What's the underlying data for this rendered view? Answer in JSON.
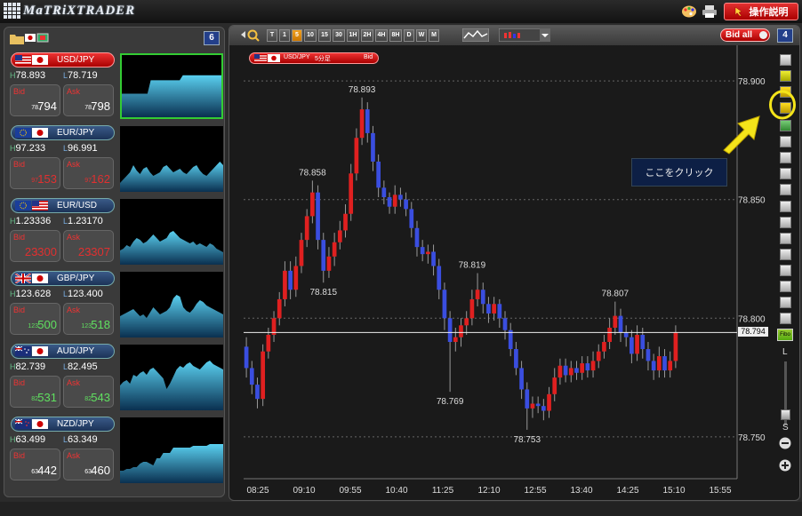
{
  "app": {
    "title": "MaTRiXTRADER",
    "help_button": "操作説明"
  },
  "left_panel": {
    "count": "6",
    "pairs": [
      {
        "name": "USD/JPY",
        "base": "us",
        "quote": "jp",
        "high": "78.893",
        "low": "78.719",
        "bid_pre": "78.",
        "bid": "794",
        "ask_pre": "78.",
        "ask": "798",
        "bid_color": "#ffffff",
        "ask_color": "#ffffff",
        "selected": true,
        "spark": [
          28,
          28,
          28,
          28,
          28,
          28,
          28,
          28,
          28,
          44,
          44,
          44,
          44,
          44,
          44,
          44,
          44,
          44,
          44,
          50,
          50,
          50,
          50,
          50,
          50,
          50,
          50,
          50,
          50,
          50,
          50,
          50
        ]
      },
      {
        "name": "EUR/JPY",
        "base": "eu",
        "quote": "jp",
        "high": "97.233",
        "low": "96.991",
        "bid_pre": "97.",
        "bid": "153",
        "ask_pre": "97.",
        "ask": "162",
        "bid_color": "#e03030",
        "ask_color": "#e03030",
        "selected": false,
        "spark": [
          10,
          14,
          18,
          22,
          30,
          24,
          20,
          26,
          28,
          22,
          18,
          20,
          22,
          28,
          30,
          26,
          22,
          24,
          26,
          22,
          20,
          24,
          28,
          30,
          24,
          20,
          18,
          22,
          26,
          30,
          34,
          30
        ]
      },
      {
        "name": "EUR/USD",
        "base": "eu",
        "quote": "us",
        "high": "1.23336",
        "low": "1.23170",
        "bid_pre": "1.",
        "bid": "23300",
        "ask_pre": "1.",
        "ask": "23307",
        "bid_color": "#e03030",
        "ask_color": "#e03030",
        "selected": false,
        "spark": [
          16,
          18,
          22,
          20,
          26,
          30,
          28,
          24,
          26,
          30,
          34,
          30,
          26,
          28,
          30,
          36,
          38,
          34,
          30,
          28,
          26,
          24,
          26,
          22,
          24,
          22,
          20,
          24,
          22,
          18,
          16,
          14
        ]
      },
      {
        "name": "GBP/JPY",
        "base": "gb",
        "quote": "jp",
        "high": "123.628",
        "low": "123.400",
        "bid_pre": "123.",
        "bid": "500",
        "ask_pre": "123.",
        "ask": "518",
        "bid_color": "#60e060",
        "ask_color": "#60e060",
        "selected": false,
        "spark": [
          24,
          26,
          28,
          30,
          32,
          28,
          24,
          26,
          22,
          28,
          34,
          30,
          26,
          28,
          30,
          34,
          44,
          48,
          46,
          34,
          30,
          28,
          32,
          38,
          42,
          40,
          36,
          34,
          32,
          30,
          28,
          26
        ]
      },
      {
        "name": "AUD/JPY",
        "base": "au",
        "quote": "jp",
        "high": "82.739",
        "low": "82.495",
        "bid_pre": "82.",
        "bid": "531",
        "ask_pre": "82.",
        "ask": "543",
        "bid_color": "#60e060",
        "ask_color": "#60e060",
        "selected": false,
        "spark": [
          28,
          32,
          34,
          30,
          40,
          38,
          42,
          44,
          40,
          46,
          48,
          44,
          40,
          36,
          24,
          30,
          38,
          46,
          50,
          48,
          52,
          54,
          50,
          48,
          46,
          50,
          54,
          56,
          52,
          50,
          48,
          46
        ]
      },
      {
        "name": "NZD/JPY",
        "base": "nz",
        "quote": "jp",
        "high": "63.499",
        "low": "63.349",
        "bid_pre": "63.",
        "bid": "442",
        "ask_pre": "63.",
        "ask": "460",
        "bid_color": "#ffffff",
        "ask_color": "#ffffff",
        "selected": false,
        "spark": [
          14,
          14,
          16,
          16,
          18,
          18,
          22,
          24,
          24,
          22,
          20,
          28,
          28,
          34,
          34,
          34,
          40,
          40,
          40,
          40,
          40,
          40,
          42,
          42,
          42,
          42,
          42,
          44,
          44,
          44,
          44,
          44
        ]
      }
    ]
  },
  "chart": {
    "toolbar": {
      "timeframes": [
        "T",
        "1",
        "5",
        "10",
        "15",
        "30",
        "1H",
        "2H",
        "4H",
        "8H",
        "D",
        "W",
        "M"
      ],
      "active_timeframe": "5",
      "bid_all": "Bid all",
      "badge": "4"
    },
    "symbol_chip": {
      "pair": "USD/JPY",
      "interval": "5分足",
      "side": "Bid"
    },
    "callout": "ここをクリック",
    "zoom_top": "L",
    "zoom_bottom": "S",
    "chart_data": {
      "type": "candlestick",
      "title": "",
      "xlabel": "",
      "ylabel": "",
      "ylim": [
        78.735,
        78.915
      ],
      "yticks": [
        78.9,
        78.85,
        78.8,
        78.75
      ],
      "ytick_labels": [
        "78.900",
        "78.850",
        "78.800",
        "78.750"
      ],
      "xticks": [
        "08:25",
        "09:10",
        "09:55",
        "10:40",
        "11:25",
        "12:10",
        "12:55",
        "13:40",
        "14:25",
        "15:10",
        "15:55"
      ],
      "current_price": "78.794",
      "annotations": [
        {
          "label": "78.893",
          "x": "09:55",
          "value": 78.893
        },
        {
          "label": "78.858",
          "x": "09:10",
          "value": 78.858
        },
        {
          "label": "78.815",
          "x": "09:10",
          "value": 78.815
        },
        {
          "label": "78.819",
          "x": "11:25",
          "value": 78.819
        },
        {
          "label": "78.769",
          "x": "11:25",
          "value": 78.769
        },
        {
          "label": "78.753",
          "x": "12:10",
          "value": 78.753
        },
        {
          "label": "78.807",
          "x": "13:40",
          "value": 78.807
        }
      ],
      "candles": [
        [
          78.788,
          78.779,
          78.792,
          78.775
        ],
        [
          78.779,
          78.772,
          78.782,
          78.768
        ],
        [
          78.772,
          78.766,
          78.775,
          78.762
        ],
        [
          78.766,
          78.786,
          78.789,
          78.763
        ],
        [
          78.786,
          78.793,
          78.796,
          78.783
        ],
        [
          78.793,
          78.8,
          78.803,
          78.79
        ],
        [
          78.8,
          78.808,
          78.811,
          78.797
        ],
        [
          78.808,
          78.82,
          78.824,
          78.805
        ],
        [
          78.82,
          78.812,
          78.824,
          78.808
        ],
        [
          78.812,
          78.822,
          78.826,
          78.809
        ],
        [
          78.822,
          78.833,
          78.836,
          78.819
        ],
        [
          78.833,
          78.843,
          78.846,
          78.83
        ],
        [
          78.843,
          78.853,
          78.858,
          78.84
        ],
        [
          78.853,
          78.833,
          78.856,
          78.829
        ],
        [
          78.833,
          78.82,
          78.836,
          78.815
        ],
        [
          78.82,
          78.826,
          78.83,
          78.817
        ],
        [
          78.826,
          78.832,
          78.836,
          78.822
        ],
        [
          78.832,
          78.837,
          78.841,
          78.829
        ],
        [
          78.837,
          78.844,
          78.848,
          78.834
        ],
        [
          78.844,
          78.861,
          78.865,
          78.841
        ],
        [
          78.861,
          78.876,
          78.88,
          78.858
        ],
        [
          78.876,
          78.888,
          78.893,
          78.873
        ],
        [
          78.888,
          78.878,
          78.891,
          78.874
        ],
        [
          78.878,
          78.866,
          78.881,
          78.862
        ],
        [
          78.866,
          78.855,
          78.869,
          78.851
        ],
        [
          78.855,
          78.851,
          78.858,
          78.848
        ],
        [
          78.851,
          78.847,
          78.853,
          78.844
        ],
        [
          78.847,
          78.852,
          78.856,
          78.844
        ],
        [
          78.852,
          78.85,
          78.855,
          78.847
        ],
        [
          78.85,
          78.846,
          78.853,
          78.843
        ],
        [
          78.846,
          78.838,
          78.849,
          78.834
        ],
        [
          78.838,
          78.83,
          78.841,
          78.826
        ],
        [
          78.83,
          78.827,
          78.833,
          78.824
        ],
        [
          78.827,
          78.828,
          78.831,
          78.823
        ],
        [
          78.828,
          78.822,
          78.831,
          78.818
        ],
        [
          78.822,
          78.812,
          78.825,
          78.808
        ],
        [
          78.812,
          78.8,
          78.815,
          78.795
        ],
        [
          78.8,
          78.79,
          78.803,
          78.769
        ],
        [
          78.79,
          78.792,
          78.796,
          78.786
        ],
        [
          78.792,
          78.797,
          78.8,
          78.788
        ],
        [
          78.797,
          78.8,
          78.803,
          78.793
        ],
        [
          78.8,
          78.808,
          78.812,
          78.797
        ],
        [
          78.808,
          78.812,
          78.819,
          78.805
        ],
        [
          78.812,
          78.806,
          78.815,
          78.802
        ],
        [
          78.806,
          78.802,
          78.809,
          78.798
        ],
        [
          78.802,
          78.806,
          78.809,
          78.799
        ],
        [
          78.806,
          78.8,
          78.808,
          78.796
        ],
        [
          78.8,
          78.795,
          78.803,
          78.791
        ],
        [
          78.795,
          78.787,
          78.798,
          78.784
        ],
        [
          78.787,
          78.779,
          78.79,
          78.776
        ],
        [
          78.779,
          78.77,
          78.782,
          78.766
        ],
        [
          78.77,
          78.762,
          78.773,
          78.753
        ],
        [
          78.762,
          78.764,
          78.767,
          78.758
        ],
        [
          78.764,
          78.763,
          78.767,
          78.76
        ],
        [
          78.763,
          78.761,
          78.766,
          78.757
        ],
        [
          78.761,
          78.768,
          78.771,
          78.758
        ],
        [
          78.768,
          78.775,
          78.779,
          78.765
        ],
        [
          78.775,
          78.78,
          78.783,
          78.772
        ],
        [
          78.78,
          78.776,
          78.783,
          78.773
        ],
        [
          78.776,
          78.779,
          78.782,
          78.773
        ],
        [
          78.779,
          78.777,
          78.782,
          78.774
        ],
        [
          78.777,
          78.781,
          78.784,
          78.774
        ],
        [
          78.781,
          78.778,
          78.784,
          78.775
        ],
        [
          78.778,
          78.782,
          78.786,
          78.775
        ],
        [
          78.782,
          78.786,
          78.789,
          78.779
        ],
        [
          78.786,
          78.79,
          78.793,
          78.783
        ],
        [
          78.79,
          78.796,
          78.8,
          78.787
        ],
        [
          78.796,
          78.801,
          78.807,
          78.793
        ],
        [
          78.801,
          78.794,
          78.804,
          78.79
        ],
        [
          78.794,
          78.792,
          78.797,
          78.788
        ],
        [
          78.792,
          78.785,
          78.795,
          78.781
        ],
        [
          78.785,
          78.793,
          78.797,
          78.782
        ],
        [
          78.793,
          78.787,
          78.796,
          78.783
        ],
        [
          78.787,
          78.782,
          78.79,
          78.778
        ],
        [
          78.782,
          78.778,
          78.785,
          78.774
        ],
        [
          78.778,
          78.784,
          78.788,
          78.775
        ],
        [
          78.784,
          78.778,
          78.787,
          78.775
        ],
        [
          78.778,
          78.782,
          78.786,
          78.775
        ],
        [
          78.782,
          78.794,
          78.797,
          78.779
        ]
      ]
    }
  },
  "colors": {
    "up": "#e02020",
    "down": "#3a4ee0",
    "accent": "#f0e010",
    "callout_bg": "#0d1f45"
  }
}
